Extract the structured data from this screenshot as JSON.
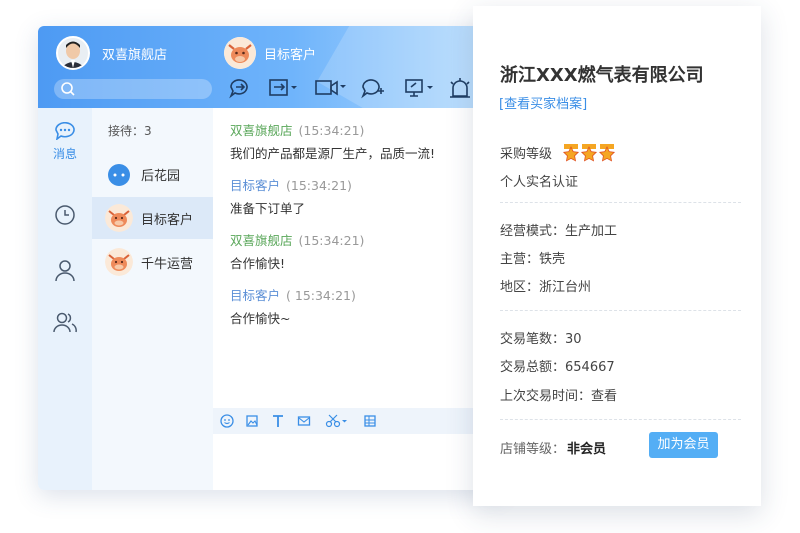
{
  "chat_window": {
    "shop_name": "双喜旗舰店",
    "target_name": "目标客户",
    "rail": {
      "messages_label": "消息"
    },
    "reception": "接待：3",
    "contacts": [
      {
        "name": "后花园"
      },
      {
        "name": "目标客户"
      },
      {
        "name": "千牛运营"
      }
    ],
    "messages": [
      {
        "sender": "双喜旗舰店",
        "time": "(15:34:21)",
        "body": "我们的产品都是源厂生产，品质一流!"
      },
      {
        "sender": "目标客户",
        "time": "(15:34:21)",
        "body": "准备下订单了"
      },
      {
        "sender": "双喜旗舰店",
        "time": "(15:34:21)",
        "body": "合作愉快!"
      },
      {
        "sender": "目标客户",
        "time": "( 15:34:21)",
        "body": "合作愉快~"
      }
    ]
  },
  "panel": {
    "company": "浙江XXX燃气表有限公司",
    "archive_link": "[查看买家档案]",
    "purchase_level": "采购等级",
    "purchase_stars": 3,
    "verification": "个人实名认证",
    "business_mode": "经营模式：生产加工",
    "main_product": "主营：铁壳",
    "region": "地区：浙江台州",
    "trade_count": "交易笔数：30",
    "trade_total": "交易总额：654667",
    "last_trade": "上次交易时间：查看",
    "shop_level_label": "店铺等级：",
    "shop_level_value": "非会员",
    "join_button": "加为会员"
  },
  "colors": {
    "header_blue": "#4d9af3",
    "accent_blue": "#3a8ee6",
    "shop_sender_green": "#5aa75a",
    "customer_sender_blue": "#5b8fd6",
    "join_button": "#54aef5",
    "star_orange": "#f5a623"
  },
  "icons": [
    "search-icon",
    "chat-bubble-icon",
    "clock-icon",
    "person-icon",
    "group-icon",
    "quick-reply-icon",
    "file-transfer-icon",
    "video-icon",
    "chat-add-icon",
    "screen-share-icon",
    "alarm-icon",
    "smile-icon",
    "image-icon",
    "text-format-icon",
    "email-icon",
    "scissors-icon",
    "table-icon",
    "star-badge-icon"
  ]
}
